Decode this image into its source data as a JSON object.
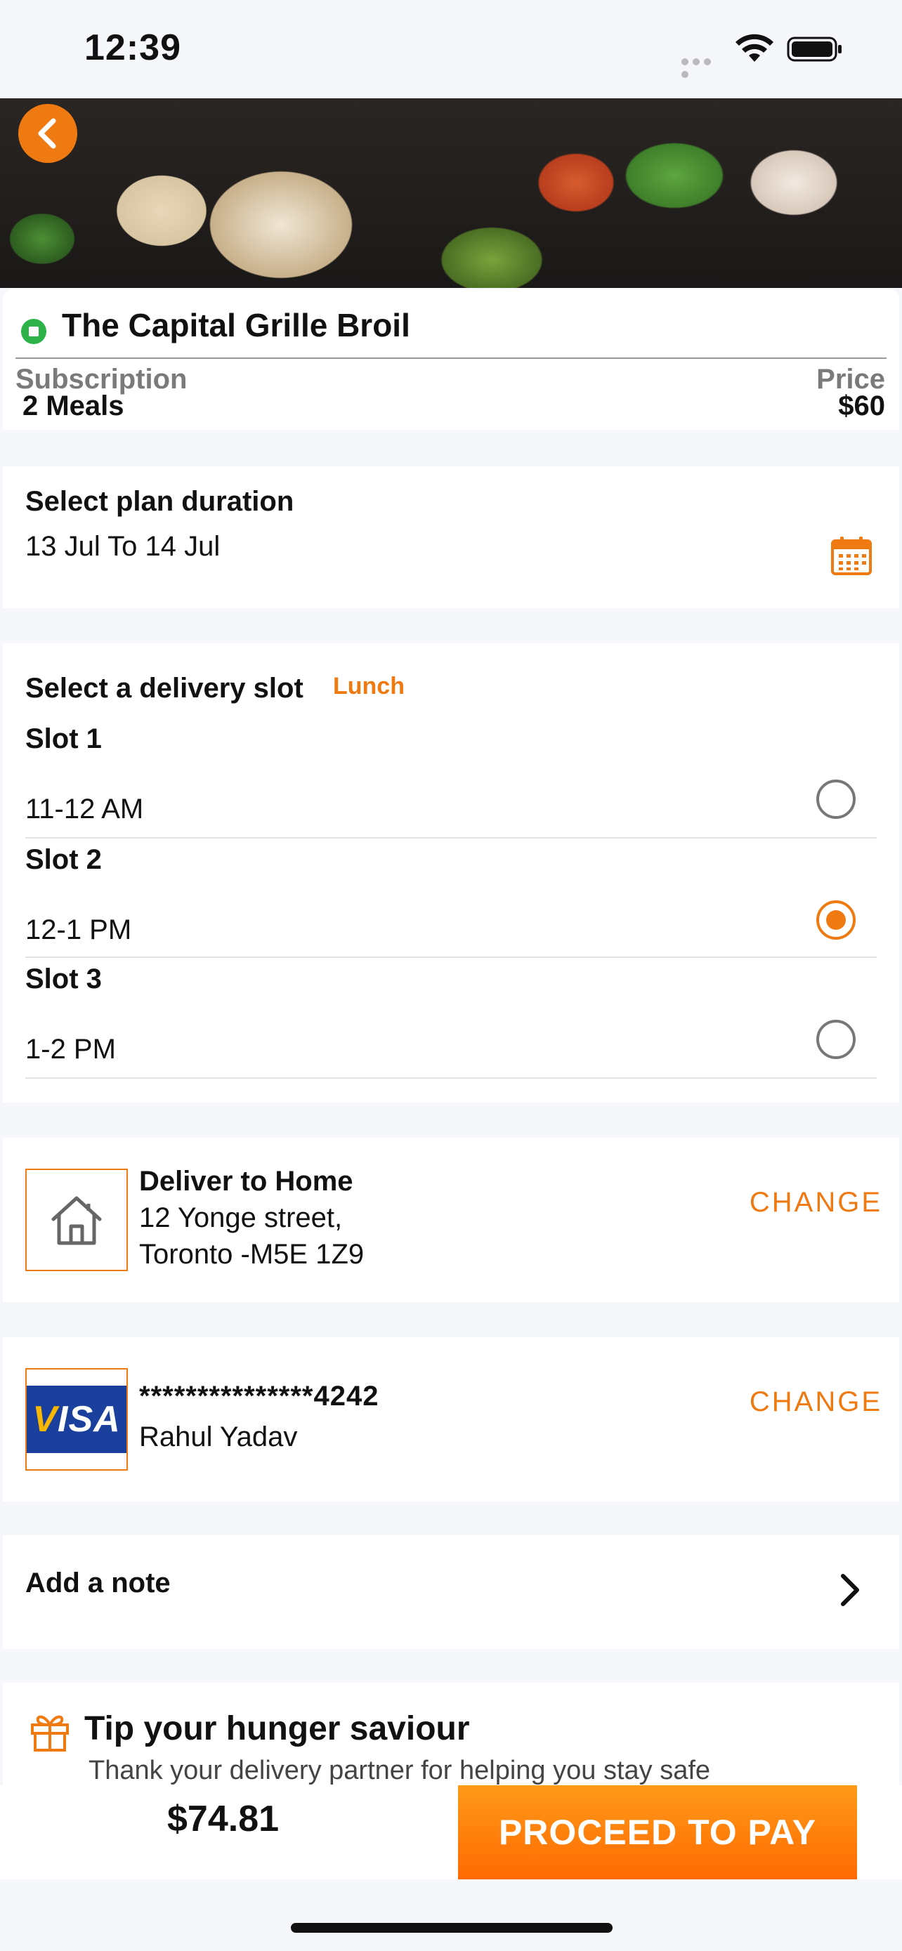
{
  "status_bar": {
    "time": "12:39"
  },
  "restaurant": {
    "name": "The Capital Grille Broil",
    "subscription_label": "Subscription",
    "subscription_value": "2 Meals",
    "price_label": "Price",
    "price_value": "$60"
  },
  "plan": {
    "title": "Select plan duration",
    "dates": "13 Jul To 14 Jul"
  },
  "delivery": {
    "title": "Select a delivery slot",
    "tag": "Lunch",
    "slots": [
      {
        "name": "Slot 1",
        "time": "11-12 AM",
        "selected": false
      },
      {
        "name": "Slot 2",
        "time": "12-1 PM",
        "selected": true
      },
      {
        "name": "Slot 3",
        "time": "1-2 PM",
        "selected": false
      }
    ]
  },
  "address": {
    "title": "Deliver to Home",
    "line1": "12 Yonge street,",
    "line2": "Toronto -M5E 1Z9",
    "change_label": "CHANGE"
  },
  "payment": {
    "card_brand": "VISA",
    "card_number": "***************4242",
    "card_holder": "Rahul Yadav",
    "change_label": "CHANGE"
  },
  "note": {
    "label": "Add a note"
  },
  "tip": {
    "title": "Tip your hunger saviour",
    "subtitle": "Thank your delivery partner for helping you stay safe"
  },
  "checkout": {
    "total": "$74.81",
    "pay_label": "PROCEED TO PAY"
  },
  "colors": {
    "accent": "#f07a12",
    "veg": "#2eb24a",
    "visa_blue": "#1a3f9c"
  }
}
